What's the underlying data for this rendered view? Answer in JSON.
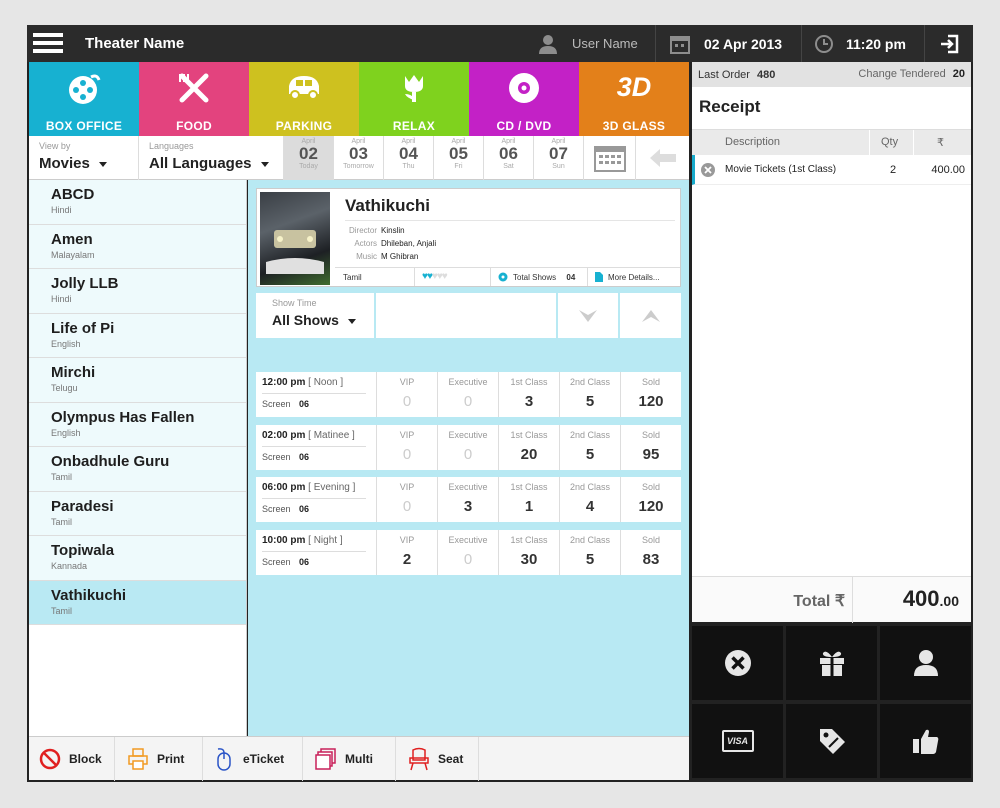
{
  "topbar": {
    "theater_name": "Theater Name",
    "user_name": "User Name",
    "date": "02 Apr 2013",
    "time": "11:20 pm"
  },
  "categories": [
    {
      "label": "BOX OFFICE",
      "color": "#17b1d1",
      "icon": "film-reel-icon"
    },
    {
      "label": "FOOD",
      "color": "#e3437e",
      "icon": "fork-knife-icon"
    },
    {
      "label": "PARKING",
      "color": "#cec11f",
      "icon": "car-icon"
    },
    {
      "label": "RELAX",
      "color": "#7fd21e",
      "icon": "tulip-icon"
    },
    {
      "label": "CD / DVD",
      "color": "#c321c6",
      "icon": "disc-icon"
    },
    {
      "label": "3D GLASS",
      "color": "#e3801a",
      "icon_text": "3D"
    }
  ],
  "filters": {
    "view_by_label": "View by",
    "view_by_value": "Movies",
    "languages_label": "Languages",
    "languages_value": "All Languages",
    "dates": [
      {
        "month": "April",
        "day": "02",
        "weekday": "Today",
        "selected": true
      },
      {
        "month": "April",
        "day": "03",
        "weekday": "Tomorrow"
      },
      {
        "month": "April",
        "day": "04",
        "weekday": "Thu"
      },
      {
        "month": "April",
        "day": "05",
        "weekday": "Fri"
      },
      {
        "month": "April",
        "day": "06",
        "weekday": "Sat"
      },
      {
        "month": "April",
        "day": "07",
        "weekday": "Sun"
      }
    ]
  },
  "movies": [
    {
      "title": "ABCD",
      "lang": "Hindi"
    },
    {
      "title": "Amen",
      "lang": "Malayalam"
    },
    {
      "title": "Jolly LLB",
      "lang": "Hindi"
    },
    {
      "title": "Life of Pi",
      "lang": "English"
    },
    {
      "title": "Mirchi",
      "lang": "Telugu"
    },
    {
      "title": "Olympus Has Fallen",
      "lang": "English"
    },
    {
      "title": "Onbadhule Guru",
      "lang": "Tamil"
    },
    {
      "title": "Paradesi",
      "lang": "Tamil"
    },
    {
      "title": "Topiwala",
      "lang": "Kannada"
    },
    {
      "title": "Vathikuchi",
      "lang": "Tamil",
      "selected": true
    }
  ],
  "detail": {
    "title": "Vathikuchi",
    "director_label": "Director",
    "director": "Kinslin",
    "actors_label": "Actors",
    "actors": "Dhileban, Anjali",
    "music_label": "Music",
    "music": "M Ghibran",
    "language": "Tamil",
    "rating": 2,
    "rating_max": 5,
    "total_shows_label": "Total Shows",
    "total_shows": "04",
    "more_details": "More Details..."
  },
  "show_filter": {
    "label": "Show Time",
    "value": "All Shows"
  },
  "show_headers": [
    "VIP",
    "Executive",
    "1st Class",
    "2nd Class",
    "Sold"
  ],
  "shows": [
    {
      "time": "12:00 pm",
      "period": "[ Noon ]",
      "screen_label": "Screen",
      "screen": "06",
      "values": [
        "0",
        "0",
        "3",
        "5",
        "120"
      ]
    },
    {
      "time": "02:00 pm",
      "period": "[ Matinee ]",
      "screen_label": "Screen",
      "screen": "06",
      "values": [
        "0",
        "0",
        "20",
        "5",
        "95"
      ]
    },
    {
      "time": "06:00 pm",
      "period": "[ Evening ]",
      "screen_label": "Screen",
      "screen": "06",
      "values": [
        "0",
        "3",
        "1",
        "4",
        "120"
      ]
    },
    {
      "time": "10:00 pm",
      "period": "[ Night ]",
      "screen_label": "Screen",
      "screen": "06",
      "values": [
        "2",
        "0",
        "30",
        "5",
        "83"
      ]
    }
  ],
  "toolbar": [
    {
      "label": "Block",
      "icon": "block-icon"
    },
    {
      "label": "Print",
      "icon": "printer-icon"
    },
    {
      "label": "eTicket",
      "icon": "mouse-icon"
    },
    {
      "label": "Multi",
      "icon": "multi-copy-icon"
    },
    {
      "label": "Seat",
      "icon": "seat-icon"
    }
  ],
  "receipt": {
    "last_order_label": "Last Order",
    "last_order": "480",
    "change_label": "Change Tendered",
    "change": "20",
    "title": "Receipt",
    "col_description": "Description",
    "col_qty": "Qty",
    "col_currency": "₹",
    "items": [
      {
        "description": "Movie Tickets (1st Class)",
        "qty": "2",
        "amount": "400.00"
      }
    ],
    "total_label": "Total ₹",
    "total_int": "400",
    "total_dec": ".00"
  },
  "actions": [
    "cancel-icon",
    "gift-icon",
    "user-icon",
    "visa-card-icon",
    "discount-tag-icon",
    "thumbs-up-icon"
  ],
  "action_visa_text": "VISA"
}
